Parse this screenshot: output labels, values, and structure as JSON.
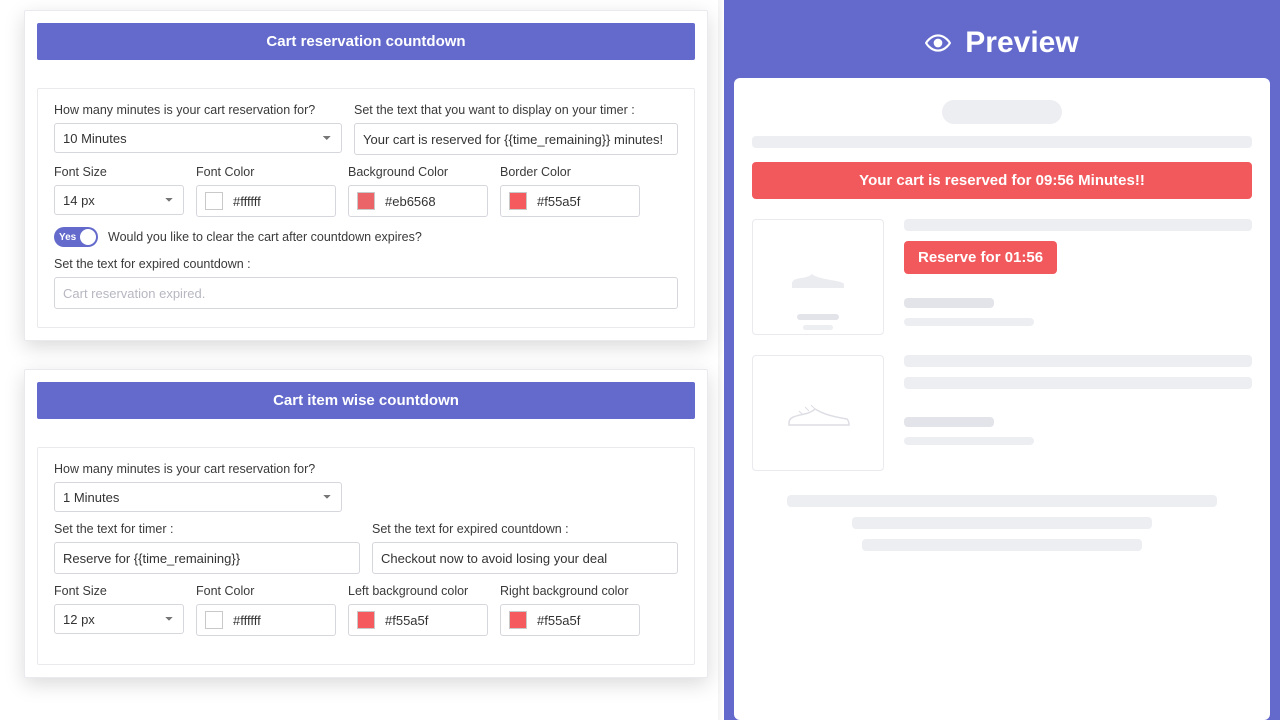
{
  "card1": {
    "title": "Cart reservation countdown",
    "minutes_label": "How many minutes is your cart reservation for?",
    "minutes_value": "10 Minutes",
    "timer_text_label": "Set the text that you want to display on your timer :",
    "timer_text_value": "Your cart is reserved for {{time_remaining}} minutes!",
    "font_size_label": "Font Size",
    "font_size_value": "14 px",
    "font_color_label": "Font Color",
    "font_color_value": "#ffffff",
    "bg_color_label": "Background Color",
    "bg_color_value": "#eb6568",
    "border_color_label": "Border Color",
    "border_color_value": "#f55a5f",
    "toggle_yes": "Yes",
    "toggle_label": "Would you like to clear the cart after countdown expires?",
    "expired_label": "Set the text for expired countdown :",
    "expired_placeholder": "Cart reservation expired."
  },
  "card2": {
    "title": "Cart item wise countdown",
    "minutes_label": "How many minutes is your cart reservation for?",
    "minutes_value": "1 Minutes",
    "timer_text_label": "Set the text for timer :",
    "timer_text_value": "Reserve for {{time_remaining}}",
    "expired_label": "Set the text for expired countdown :",
    "expired_value": "Checkout now to avoid losing your deal",
    "font_size_label": "Font Size",
    "font_size_value": "12 px",
    "font_color_label": "Font Color",
    "font_color_value": "#ffffff",
    "left_bg_label": "Left background color",
    "left_bg_value": "#f55a5f",
    "right_bg_label": "Right background color",
    "right_bg_value": "#f55a5f"
  },
  "preview": {
    "title": "Preview",
    "banner": "Your cart is reserved for 09:56 Minutes!!",
    "reserve_button": "Reserve for 01:56"
  },
  "colors": {
    "white": "#ffffff",
    "red1": "#eb6568",
    "red2": "#f55a5f"
  }
}
